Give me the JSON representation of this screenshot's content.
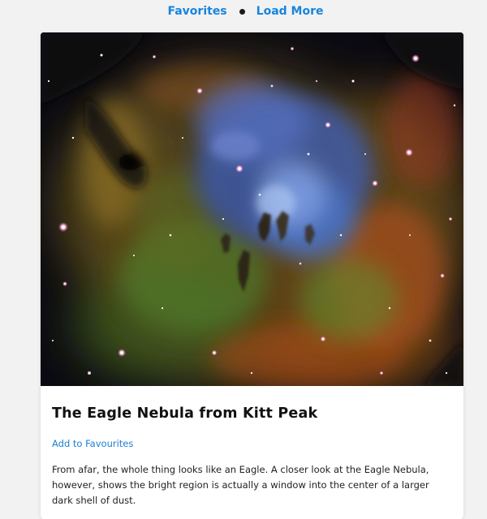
{
  "nav": {
    "favorites_label": "Favorites",
    "load_more_label": "Load More"
  },
  "post": {
    "image_alt": "The Eagle Nebula from Kitt Peak",
    "title": "The Eagle Nebula from Kitt Peak",
    "favourite_label": "Add to Favourites",
    "description": "From afar, the whole thing looks like an Eagle. A closer look at the Eagle Nebula, however, shows the bright region is actually a window into the center of a larger dark shell of dust."
  },
  "colors": {
    "link": "#1685de",
    "background": "#f2f2f2"
  }
}
